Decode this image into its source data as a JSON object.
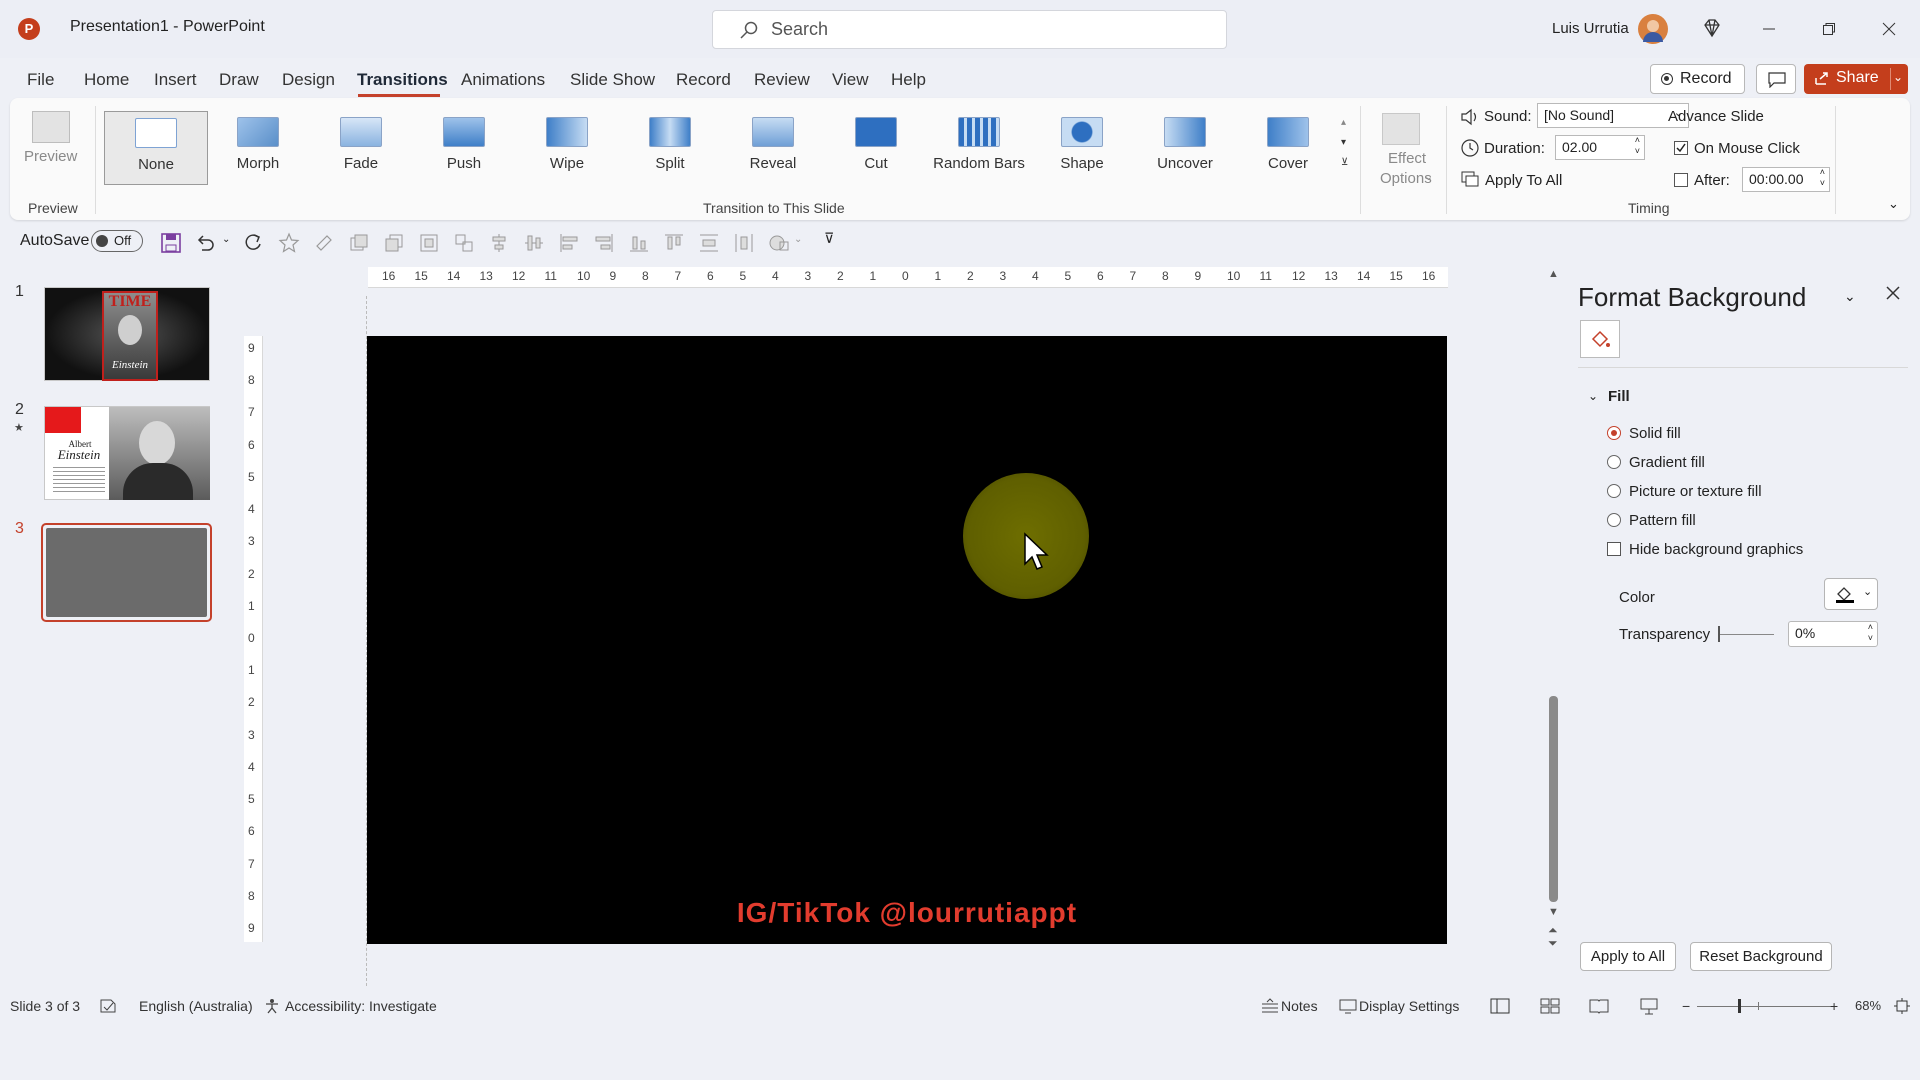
{
  "titlebar": {
    "title": "Presentation1  -  PowerPoint",
    "search_placeholder": "Search",
    "user_name": "Luis Urrutia"
  },
  "menu": {
    "tabs": [
      "File",
      "Home",
      "Insert",
      "Draw",
      "Design",
      "Transitions",
      "Animations",
      "Slide Show",
      "Record",
      "Review",
      "View",
      "Help"
    ],
    "active_tab": "Transitions",
    "record_label": "Record",
    "share_label": "Share"
  },
  "ribbon": {
    "preview_label": "Preview",
    "preview_group": "Preview",
    "transitions": [
      "None",
      "Morph",
      "Fade",
      "Push",
      "Wipe",
      "Split",
      "Reveal",
      "Cut",
      "Random Bars",
      "Shape",
      "Uncover",
      "Cover"
    ],
    "selected_transition": "None",
    "group_transition": "Transition to This Slide",
    "effect_options_1": "Effect",
    "effect_options_2": "Options",
    "sound_label": "Sound:",
    "sound_value": "[No Sound]",
    "duration_label": "Duration:",
    "duration_value": "02.00",
    "apply_all_label": "Apply To All",
    "advance_label": "Advance Slide",
    "on_click_label": "On Mouse Click",
    "on_click_checked": true,
    "after_label": "After:",
    "after_value": "00:00.00",
    "timing_group": "Timing"
  },
  "qat": {
    "autosave_label": "AutoSave",
    "autosave_state": "Off"
  },
  "slides": [
    {
      "num": "1",
      "title": "TIME",
      "subtitle": "Einstein"
    },
    {
      "num": "2",
      "title": "Albert",
      "subtitle": "Einstein"
    },
    {
      "num": "3",
      "title": "",
      "subtitle": ""
    }
  ],
  "slide": {
    "watermark": "IG/TikTok @lourrutiappt",
    "background": "#000000",
    "cursor_highlight": "#6b6b00"
  },
  "ruler": {
    "h_ticks": [
      "16",
      "15",
      "14",
      "13",
      "12",
      "11",
      "10",
      "9",
      "8",
      "7",
      "6",
      "5",
      "4",
      "3",
      "2",
      "1",
      "0",
      "1",
      "2",
      "3",
      "4",
      "5",
      "6",
      "7",
      "8",
      "9",
      "10",
      "11",
      "12",
      "13",
      "14",
      "15",
      "16"
    ],
    "v_ticks": [
      "9",
      "8",
      "7",
      "6",
      "5",
      "4",
      "3",
      "2",
      "1",
      "0",
      "1",
      "2",
      "3",
      "4",
      "5",
      "6",
      "7",
      "8",
      "9"
    ]
  },
  "pane": {
    "title": "Format Background",
    "section": "Fill",
    "options": [
      "Solid fill",
      "Gradient fill",
      "Picture or texture fill",
      "Pattern fill"
    ],
    "selected_option": "Solid fill",
    "hide_graphics_label": "Hide background graphics",
    "color_label": "Color",
    "transparency_label": "Transparency",
    "transparency_value": "0%",
    "apply_all_label": "Apply to All",
    "reset_label": "Reset Background"
  },
  "status": {
    "slide_info": "Slide 3 of 3",
    "language": "English (Australia)",
    "accessibility": "Accessibility: Investigate",
    "notes": "Notes",
    "display_settings": "Display Settings",
    "zoom": "68%"
  },
  "colors": {
    "accent": "#c4412b",
    "share": "#c43e1c",
    "selected_thumb_border": "#c4412b"
  }
}
